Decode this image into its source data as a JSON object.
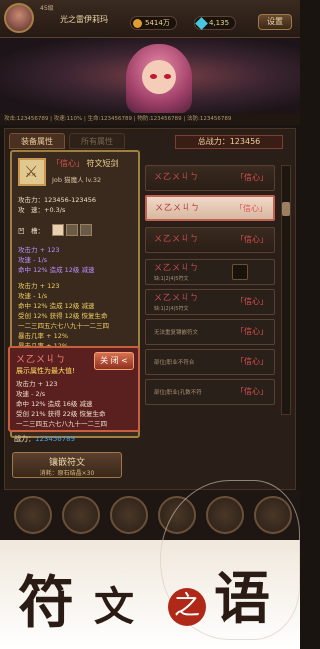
{
  "hud": {
    "level": "45级",
    "player_name": "光之雷伊莉玛",
    "gold": "5414万",
    "gems": "4,135",
    "settings": "设置"
  },
  "stats_line": "攻击:123456789 | 攻速:110% | 生命:123456789 | 物防:123456789 | 法防:123456789",
  "tabs": {
    "equip": "装备属性",
    "all": "所有属性"
  },
  "power_label": "总战力：123456",
  "rune_list": [
    {
      "runes": "ㄨ乙ㄨ丩ㄅ",
      "name": "「信心」",
      "style": "normal"
    },
    {
      "runes": "ㄨ乙ㄨ丩ㄅ",
      "name": "「信心」",
      "style": "selected"
    },
    {
      "runes": "ㄨ乙ㄨ丩ㄅ",
      "name": "「信心」",
      "style": "normal"
    },
    {
      "runes": "ㄨ乙ㄨ丩ㄅ",
      "name": "",
      "sub": "缺:1|2|4|5符文",
      "style": "dim"
    },
    {
      "runes": "ㄨ乙ㄨ丩ㄅ",
      "name": "「信心」",
      "sub": "缺:1|2|4|5符文",
      "style": "dim"
    },
    {
      "lock": "无法重复镶嵌符文",
      "name": "「信心」",
      "style": "dim"
    },
    {
      "lock": "部位|职业不符合",
      "name": "「信心」",
      "style": "dim"
    },
    {
      "lock": "部位|职业|孔数不符",
      "name": "「信心」",
      "style": "dim"
    }
  ],
  "tooltip": {
    "name_quote": "「信心」",
    "name_item": "符文短剑",
    "class_line": "Job 猫魔人  lv.32",
    "attack": "攻击力：123456-123456",
    "speed": "攻　速：+0.3/s",
    "slot_label": "凹　槽：",
    "lines_a": [
      "攻击力 + 123",
      "攻速 - 1/s",
      "命中 12% 造成 12级 减速"
    ],
    "lines_b": [
      "攻击力 + 123",
      "攻速 - 1/s",
      "命中 12% 造成 12级 减速",
      "受创 12% 获得 12级 恢复生命",
      "一二三四五六七八九十一二三四",
      "暴击几率 + 12%",
      "暴击几率 + 12%"
    ]
  },
  "popup": {
    "runes": "ㄨ乙ㄨ丩ㄅ",
    "title": "展示属性为最大值!",
    "close": "关 闭 <",
    "lines": [
      "攻击力 + 123",
      "攻速 - 2/s",
      "命中 12% 造成 16级 减速",
      "受创 21% 获得 22级 恢复生命",
      "一二三四五六七八九十一二三四"
    ]
  },
  "power_bottom": {
    "label": "战力：",
    "value": "123456789"
  },
  "inlay": {
    "label": "镶嵌符文",
    "cost": "消耗：原石结晶×30"
  },
  "banner": {
    "c1": "符",
    "c2": "文",
    "c3": "之",
    "c4": "语"
  }
}
